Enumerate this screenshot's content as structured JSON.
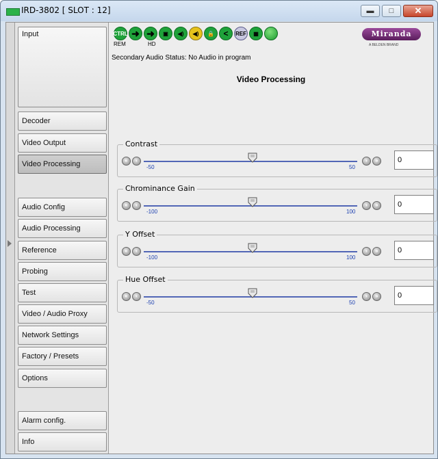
{
  "window": {
    "title": "IRD-3802 [ SLOT : 12]"
  },
  "sidebar": {
    "items": [
      {
        "label": "Input"
      },
      {
        "label": "Decoder"
      },
      {
        "label": "Video Output"
      },
      {
        "label": "Video Processing"
      },
      {
        "label": "Audio Config"
      },
      {
        "label": "Audio Processing"
      },
      {
        "label": "Reference"
      },
      {
        "label": "Probing"
      },
      {
        "label": "Test"
      },
      {
        "label": "Video / Audio Proxy"
      },
      {
        "label": "Network Settings"
      },
      {
        "label": "Factory / Presets"
      },
      {
        "label": "Options"
      },
      {
        "label": "Alarm config."
      },
      {
        "label": "Info"
      }
    ],
    "active": "Video Processing"
  },
  "status_icons": {
    "ctrl": "CTRL",
    "rem_label": "REM",
    "hd_label": "HD",
    "ref": "REF",
    "colors": {
      "ok_green": "#1fa23a",
      "warn_yellow": "#e6c21c"
    }
  },
  "logo": {
    "text": "Miranda",
    "subtext": "A BELDEN BRAND"
  },
  "secondary_status": "Secondary Audio Status: No Audio in program",
  "section_title": "Video Processing",
  "controls": [
    {
      "label": "Contrast",
      "min": "-50",
      "max": "50",
      "value": "0"
    },
    {
      "label": "Chrominance Gain",
      "min": "-100",
      "max": "100",
      "value": "0"
    },
    {
      "label": "Y Offset",
      "min": "-100",
      "max": "100",
      "value": "0"
    },
    {
      "label": "Hue Offset",
      "min": "-50",
      "max": "50",
      "value": "0"
    }
  ]
}
